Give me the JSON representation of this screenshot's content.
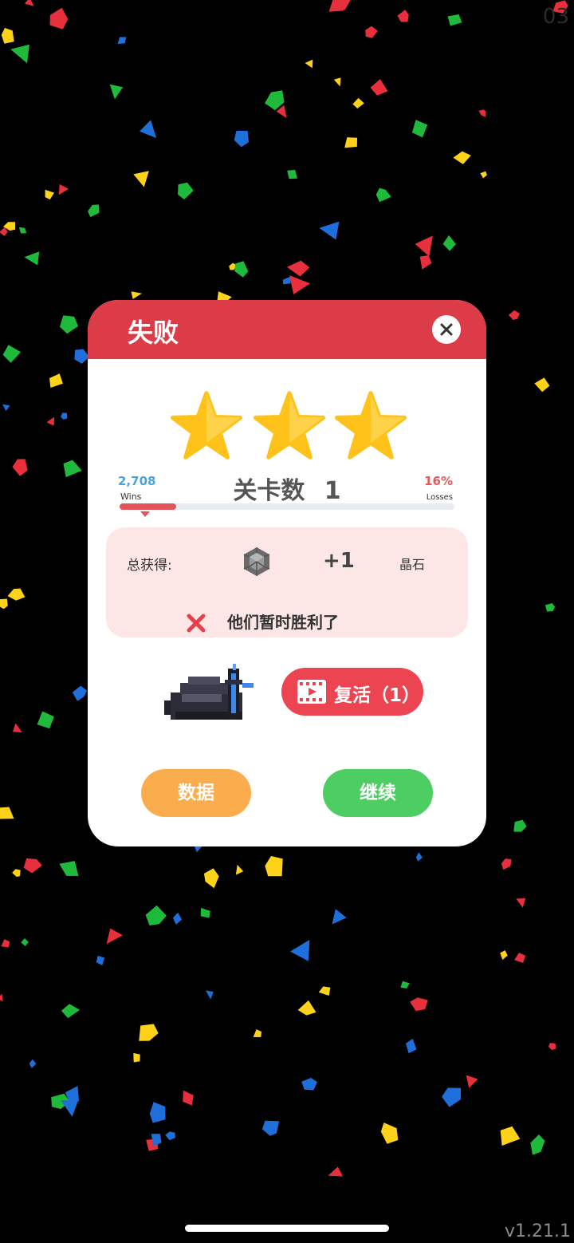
{
  "corner_text": "03",
  "version": "v1.21.1",
  "dialog": {
    "title": "失败",
    "stars": 3,
    "stats": {
      "wins_value": "2,708",
      "wins_label": "Wins",
      "losses_value": "16%",
      "losses_label": "Losses",
      "level_label": "关卡数",
      "level_number": "1",
      "progress": 0.17
    },
    "reward": {
      "label": "总获得:",
      "amount": "+1",
      "unit": "晶石",
      "result_message": "他们暂时胜利了"
    },
    "revive_label": "复活（1）",
    "buttons": {
      "data_label": "数据",
      "continue_label": "继续"
    }
  },
  "colors": {
    "header": "#dc3c48",
    "star": "#ffc21a",
    "reward_bg": "#fde6e6",
    "revive": "#ed4452",
    "data_button": "#fbac4c",
    "continue_button": "#4cce62"
  }
}
